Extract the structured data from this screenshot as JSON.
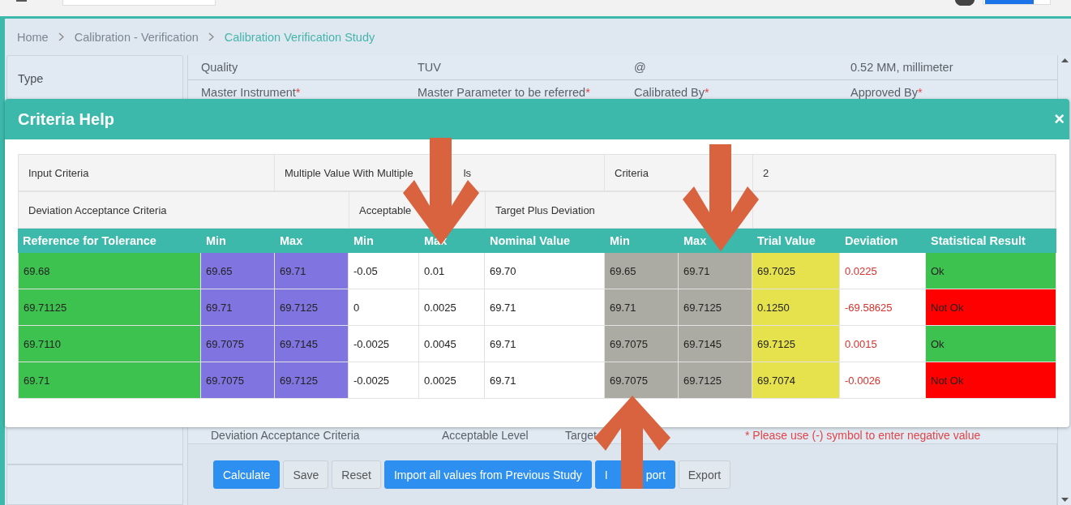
{
  "breadcrumb": [
    {
      "label": "Home",
      "current": false
    },
    {
      "label": "Calibration - Verification",
      "current": false
    },
    {
      "label": "Calibration Verification Study",
      "current": true
    }
  ],
  "sidebar": {
    "items": [
      "Type"
    ]
  },
  "form": {
    "rows": [
      [
        {
          "label": "Quality"
        },
        {
          "label": "TUV"
        },
        {
          "label": "@"
        },
        {
          "label": "0.52 MM, millimeter"
        }
      ],
      [
        {
          "label": "Master Instrument",
          "mark": "*"
        },
        {
          "label": "Master Parameter to be referred",
          "mark": "*"
        },
        {
          "label": "Calibrated By",
          "mark": "*"
        },
        {
          "label": "Approved By",
          "mark": "*"
        }
      ]
    ]
  },
  "modal": {
    "title": "Criteria Help",
    "close": "×",
    "info_rows": [
      [
        "Input Criteria",
        [
          "Multiple Value With Multiple",
          "ls"
        ],
        "Criteria",
        "2"
      ],
      [
        "Deviation Acceptance Criteria",
        "Acceptable",
        "Target Plus Deviation"
      ]
    ],
    "columns": [
      "Reference for Tolerance",
      "Min",
      "Max",
      "Min",
      "Max",
      "Nominal Value",
      "Min",
      "Max",
      "Trial Value",
      "Deviation",
      "Statistical Result"
    ],
    "rows": [
      {
        "cells": [
          "69.68",
          "69.65",
          "69.71",
          "-0.05",
          "0.01",
          "69.70",
          "69.65",
          "69.71",
          "69.7025",
          "0.0225"
        ],
        "result": {
          "text": "Ok",
          "color": "#3ec24f"
        }
      },
      {
        "cells": [
          "69.71125",
          "69.71",
          "69.7125",
          "0",
          "0.0025",
          "69.71",
          "69.71",
          "69.7125",
          "0.1250",
          "-69.58625"
        ],
        "result": {
          "text": "Not Ok",
          "color": "#ff0000"
        }
      },
      {
        "cells": [
          "69.7110",
          "69.7075",
          "69.7145",
          "-0.0025",
          "0.0045",
          "69.71",
          "69.7075",
          "69.7145",
          "69.7125",
          "0.0015"
        ],
        "result": {
          "text": "Ok",
          "color": "#3ec24f"
        }
      },
      {
        "cells": [
          "69.71",
          "69.7075",
          "69.7125",
          "-0.0025",
          "0.0025",
          "69.71",
          "69.7075",
          "69.7125",
          "69.7074",
          "-0.0026"
        ],
        "result": {
          "text": "Not Ok",
          "color": "#ff0000"
        }
      }
    ]
  },
  "lower_row": {
    "labels": [
      "Deviation Acceptance Criteria",
      "Acceptable Level",
      "Target"
    ],
    "note": "* Please use (-) symbol to enter negative value"
  },
  "actions": [
    {
      "label": "Calculate",
      "kind": "primary"
    },
    {
      "label": "Save",
      "kind": "default"
    },
    {
      "label": "Reset",
      "kind": "default"
    },
    {
      "label": "Import all values from Previous Study",
      "kind": "primary"
    },
    {
      "label": "I",
      "label_after": "port",
      "kind": "primary"
    },
    {
      "label": "Export",
      "kind": "default"
    }
  ]
}
